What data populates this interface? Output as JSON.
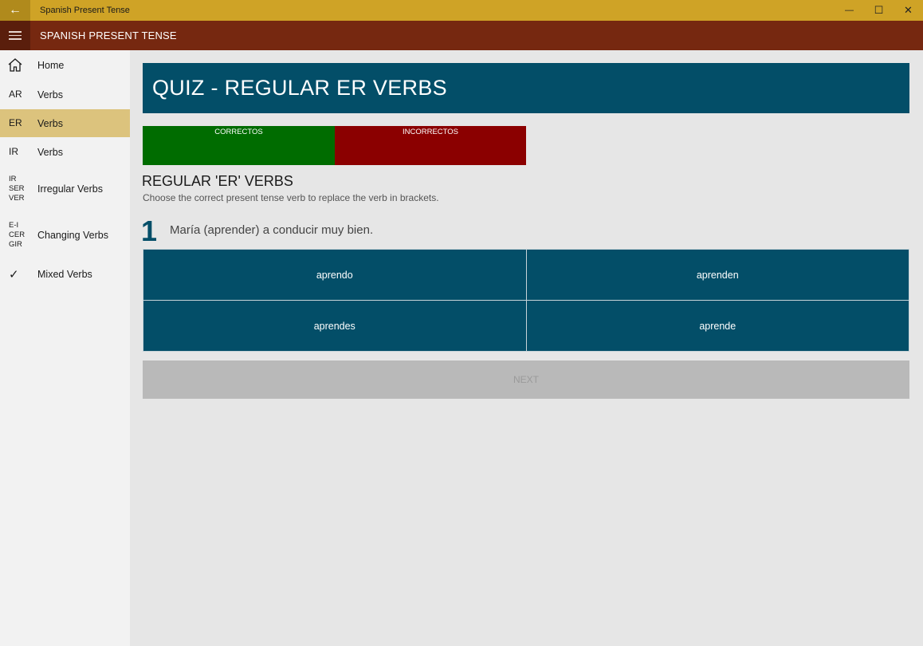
{
  "window": {
    "title": "Spanish Present Tense",
    "back_icon": "←",
    "minimize_icon": "—",
    "maximize_icon": "☐",
    "close_icon": "✕"
  },
  "appbar": {
    "title": "SPANISH PRESENT TENSE"
  },
  "sidebar": {
    "items": [
      {
        "icon": "",
        "label": "Home"
      },
      {
        "icon": "AR",
        "label": "Verbs"
      },
      {
        "icon": "ER",
        "label": "Verbs"
      },
      {
        "icon": "IR",
        "label": "Verbs"
      },
      {
        "icon": "IR\nSER\nVER",
        "label": "Irregular Verbs"
      },
      {
        "icon": "E-I\nCER\nGIR",
        "label": "Changing Verbs"
      },
      {
        "icon": "✓",
        "label": "Mixed Verbs"
      }
    ]
  },
  "main": {
    "header": "QUIZ - REGULAR ER VERBS",
    "score": {
      "correct_label": "CORRECTOS",
      "incorrect_label": "INCORRECTOS"
    },
    "section_title": "REGULAR 'ER' VERBS",
    "section_subtitle": "Choose the correct present tense verb to replace the verb in brackets.",
    "question_number": "1",
    "question_text": "María (aprender) a conducir muy bien.",
    "answers": [
      "aprendo",
      "aprenden",
      "aprendes",
      "aprende"
    ],
    "next_label": "NEXT"
  },
  "colors": {
    "titlebar": "#cfa326",
    "appbar": "#762810",
    "accent": "#034e68",
    "selected_nav": "#dcc37d",
    "correct": "#006c00",
    "incorrect": "#8b0000"
  }
}
